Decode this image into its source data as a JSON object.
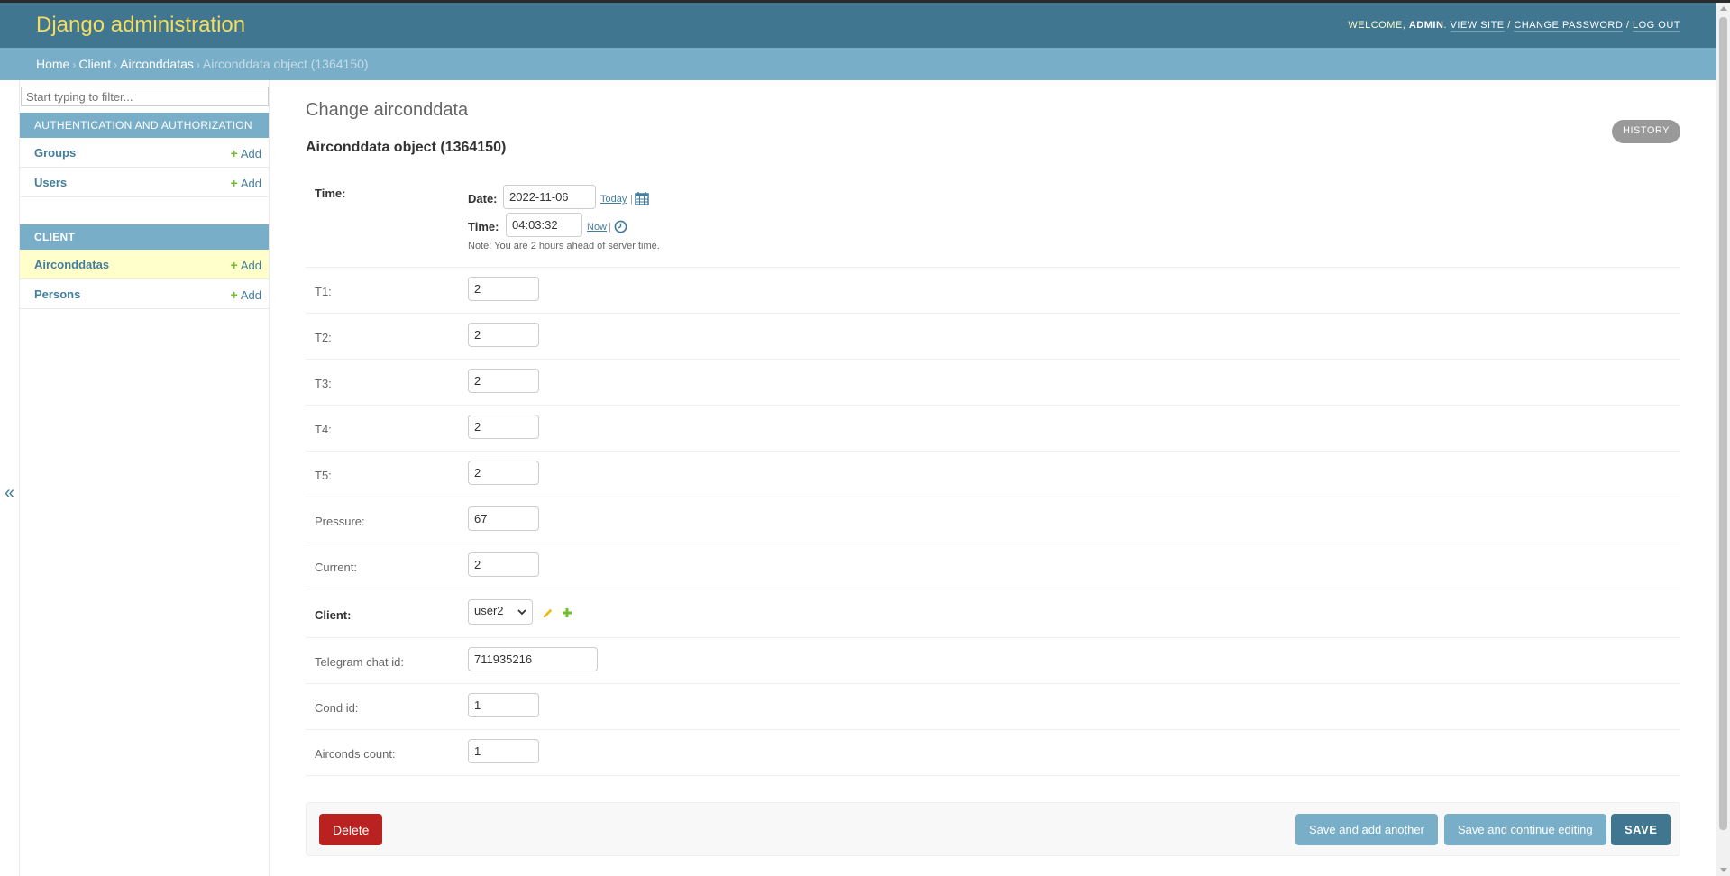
{
  "header": {
    "branding": "Django administration",
    "welcome": "Welcome,",
    "username": "admin",
    "view_site": "View site",
    "change_password": "Change password",
    "log_out": "Log out"
  },
  "breadcrumbs": {
    "home": "Home",
    "app": "Client",
    "model": "Airconddatas",
    "current": "Airconddata object (1364150)"
  },
  "sidebar": {
    "toggle": "«",
    "filter_placeholder": "Start typing to filter...",
    "modules": [
      {
        "caption": "Authentication and Authorization",
        "items": [
          {
            "name": "Groups",
            "add": "Add"
          },
          {
            "name": "Users",
            "add": "Add"
          }
        ]
      },
      {
        "caption": "Client",
        "items": [
          {
            "name": "Airconddatas",
            "add": "Add"
          },
          {
            "name": "Persons",
            "add": "Add"
          }
        ]
      }
    ]
  },
  "content": {
    "page_title": "Change airconddata",
    "object_title": "Airconddata object (1364150)",
    "history": "History",
    "fields": {
      "time": {
        "label": "Time:",
        "date_label": "Date:",
        "date_value": "2022-11-06",
        "date_shortcut": "Today",
        "time_label": "Time:",
        "time_value": "04:03:32",
        "time_shortcut": "Now",
        "sep": "|",
        "note": "Note: You are 2 hours ahead of server time."
      },
      "t1": {
        "label": "T1:",
        "value": "2"
      },
      "t2": {
        "label": "T2:",
        "value": "2"
      },
      "t3": {
        "label": "T3:",
        "value": "2"
      },
      "t4": {
        "label": "T4:",
        "value": "2"
      },
      "t5": {
        "label": "T5:",
        "value": "2"
      },
      "pressure": {
        "label": "Pressure:",
        "value": "67"
      },
      "current": {
        "label": "Current:",
        "value": "2"
      },
      "client": {
        "label": "Client:",
        "value": "user2"
      },
      "telegram": {
        "label": "Telegram chat id:",
        "value": "711935216"
      },
      "cond_id": {
        "label": "Cond id:",
        "value": "1"
      },
      "airconds_count": {
        "label": "Airconds count:",
        "value": "1"
      }
    },
    "submit": {
      "delete": "Delete",
      "save_add_another": "Save and add another",
      "save_continue": "Save and continue editing",
      "save": "Save"
    }
  },
  "colors": {
    "header": "#417690",
    "branding": "#f5dd5d",
    "module_caption": "#79aec8",
    "link": "#447e9b",
    "add_plus": "#70bf2b",
    "delete": "#ba2121",
    "current_row": "#ffffcc"
  }
}
